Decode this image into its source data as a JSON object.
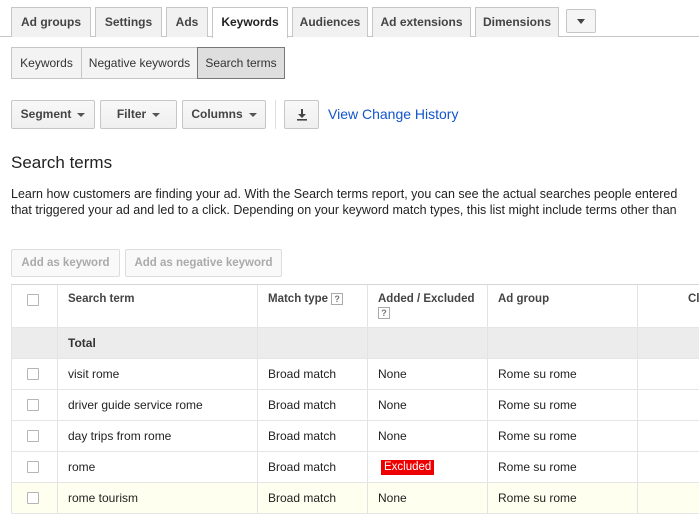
{
  "tabs": [
    {
      "label": "Ad groups"
    },
    {
      "label": "Settings"
    },
    {
      "label": "Ads"
    },
    {
      "label": "Keywords"
    },
    {
      "label": "Audiences"
    },
    {
      "label": "Ad extensions"
    },
    {
      "label": "Dimensions"
    }
  ],
  "active_tab": "Keywords",
  "subtabs": [
    {
      "label": "Keywords"
    },
    {
      "label": "Negative keywords"
    },
    {
      "label": "Search terms"
    }
  ],
  "active_subtab": "Search terms",
  "toolbar": {
    "segment": "Segment",
    "filter": "Filter",
    "columns": "Columns",
    "download_icon": "download-icon",
    "history_link": "View Change History"
  },
  "page": {
    "title": "Search terms",
    "desc_line1": "Learn how customers are finding your ad. With the Search terms report, you can see the actual searches people entered",
    "desc_line2": "that triggered your ad and led to a click. Depending on your keyword match types, this list might include terms other than"
  },
  "actions": {
    "add_keyword": "Add as keyword",
    "add_negative": "Add as negative keyword"
  },
  "table": {
    "columns": {
      "search_term": "Search term",
      "match_type": "Match type",
      "added_excluded": "Added / Excluded",
      "ad_group": "Ad group",
      "clicks_partial": "Cl"
    },
    "total_label": "Total",
    "rows": [
      {
        "term": "visit rome",
        "match": "Broad match",
        "status": "None",
        "ad_group": "Rome su rome"
      },
      {
        "term": "driver guide service rome",
        "match": "Broad match",
        "status": "None",
        "ad_group": "Rome su rome"
      },
      {
        "term": "day trips from rome",
        "match": "Broad match",
        "status": "None",
        "ad_group": "Rome su rome"
      },
      {
        "term": "rome",
        "match": "Broad match",
        "status": "Excluded",
        "ad_group": "Rome su rome"
      },
      {
        "term": "rome tourism",
        "match": "Broad match",
        "status": "None",
        "ad_group": "Rome su rome"
      }
    ]
  },
  "colors": {
    "link": "#1155cc",
    "excluded_badge": "#ee0000",
    "highlight_row": "#fffff0"
  }
}
